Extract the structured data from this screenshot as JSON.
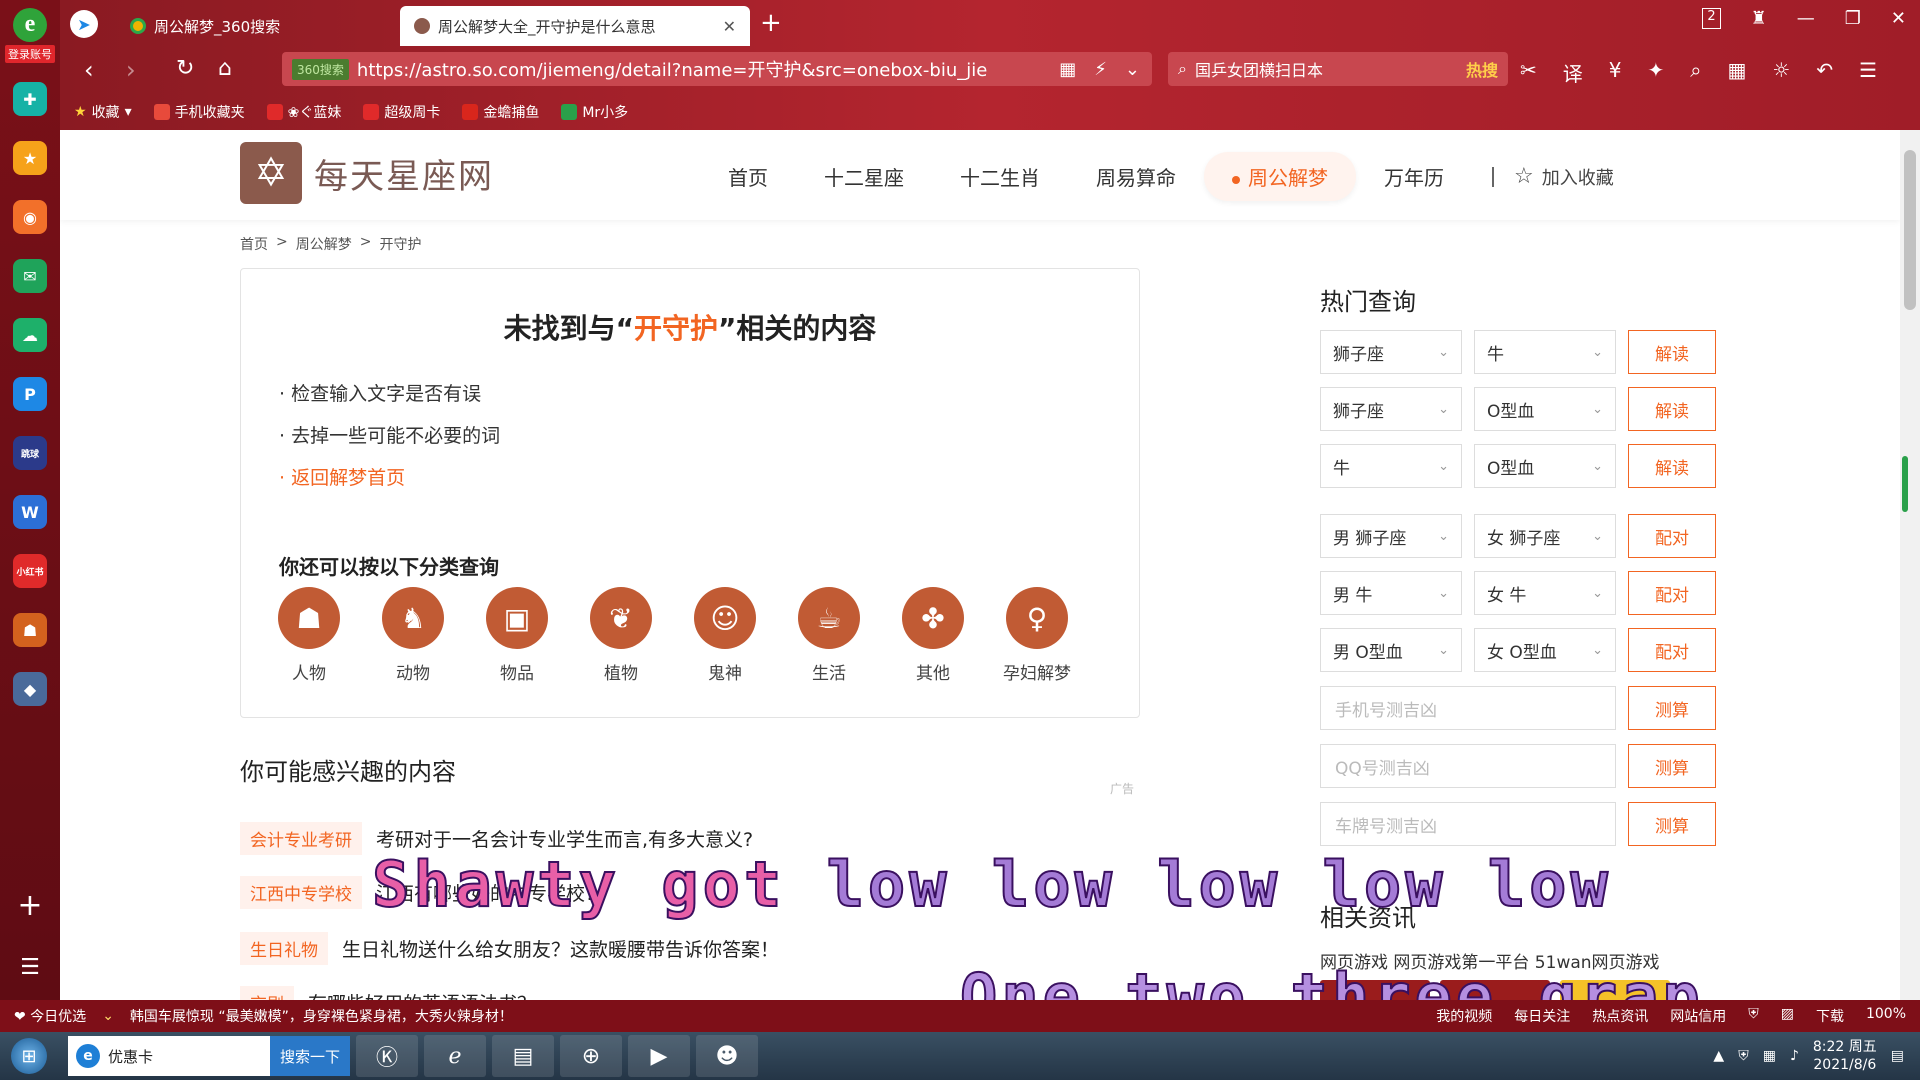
{
  "sidebar": {
    "account": "登录账号",
    "icons": [
      "plus-icon",
      "star-icon",
      "weibo-icon",
      "mail-icon",
      "cloud-icon",
      "p-icon",
      "game-icon",
      "doc-icon",
      "mi-icon",
      "game2-icon",
      "game3-icon"
    ],
    "app_labels": {
      "game1": "跳球",
      "xiaohongshu": "小红书"
    }
  },
  "browser": {
    "tabs": [
      {
        "label": "周公解梦_360搜索"
      },
      {
        "label": "周公解梦大全_开守护是什么意思"
      }
    ],
    "address": {
      "badge": "360搜索",
      "url": "https://astro.so.com/jiemeng/detail?name=开守护&src=onebox-biu_jiemeng"
    },
    "search": {
      "text": "国乒女团横扫日本",
      "hot": "热搜"
    },
    "tab_count": "2",
    "bookmarks": [
      {
        "label": "收藏"
      },
      {
        "label": "手机收藏夹"
      },
      {
        "label": "❀ぐ蓝妹"
      },
      {
        "label": "超级周卡"
      },
      {
        "label": "金蟾捕鱼"
      },
      {
        "label": "Mr小多"
      }
    ]
  },
  "site": {
    "name": "每天星座网",
    "nav": [
      {
        "label": "首页"
      },
      {
        "label": "十二星座"
      },
      {
        "label": "十二生肖"
      },
      {
        "label": "周易算命"
      },
      {
        "label": "周公解梦"
      },
      {
        "label": "万年历"
      }
    ],
    "favorite": "加入收藏"
  },
  "breadcrumb": {
    "items": [
      "首页",
      "周公解梦",
      "开守护"
    ],
    "sep": ">"
  },
  "notfound": {
    "title_prefix": "未找到与“",
    "keyword": "开守护",
    "title_suffix": "”相关的内容",
    "hints": [
      "· 检查输入文字是否有误",
      "· 去掉一些可能不必要的词",
      "· 返回解梦首页"
    ],
    "categories_title": "你还可以按以下分类查询",
    "categories": [
      "人物",
      "动物",
      "物品",
      "植物",
      "鬼神",
      "生活",
      "其他",
      "孕妇解梦"
    ]
  },
  "recommend": {
    "title": "你可能感兴趣的内容",
    "ad_label": "广告",
    "items": [
      {
        "tag": "会计专业考研",
        "text": "考研对于一名会计专业学生而言,有多大意义?"
      },
      {
        "tag": "江西中专学校",
        "text": "江西有哪些好的中专学校?"
      },
      {
        "tag": "生日礼物",
        "text": "生日礼物送什么给女朋友？这款暖腰带告诉你答案！"
      },
      {
        "tag": "京剧",
        "text": "有哪些好用的英语语法书？"
      }
    ]
  },
  "hotquery": {
    "title": "热门查询",
    "rows": [
      {
        "a": "狮子座",
        "b": "牛",
        "btn": "解读"
      },
      {
        "a": "狮子座",
        "b": "O型血",
        "btn": "解读"
      },
      {
        "a": "牛",
        "b": "O型血",
        "btn": "解读"
      },
      {
        "a": "男 狮子座",
        "b": "女 狮子座",
        "btn": "配对"
      },
      {
        "a": "男 牛",
        "b": "女 牛",
        "btn": "配对"
      },
      {
        "a": "男 O型血",
        "b": "女 O型血",
        "btn": "配对"
      }
    ],
    "inputs": [
      {
        "placeholder": "手机号测吉凶",
        "btn": "测算"
      },
      {
        "placeholder": "QQ号测吉凶",
        "btn": "测算"
      },
      {
        "placeholder": "车牌号测吉凶",
        "btn": "测算"
      }
    ],
    "related_title": "相关资讯",
    "related_text": "网页游戏 网页游戏第一平台 51wan网页游戏"
  },
  "overlay": {
    "line1_a": "Shawty got ",
    "line1_b": "low low low low low",
    "line2": "One two three grap"
  },
  "ticker": {
    "left": "今日优选",
    "news": "韩国车展惊现 “最美嫩模”，身穿裸色紧身裙，大秀火辣身材！",
    "right": [
      "我的视频",
      "每日关注",
      "热点资讯",
      "网站信用",
      "下载",
      "100%"
    ]
  },
  "taskbar": {
    "search_value": "优惠卡",
    "search_button": "搜索一下",
    "time": "8:22 周五",
    "date": "2021/8/6"
  }
}
